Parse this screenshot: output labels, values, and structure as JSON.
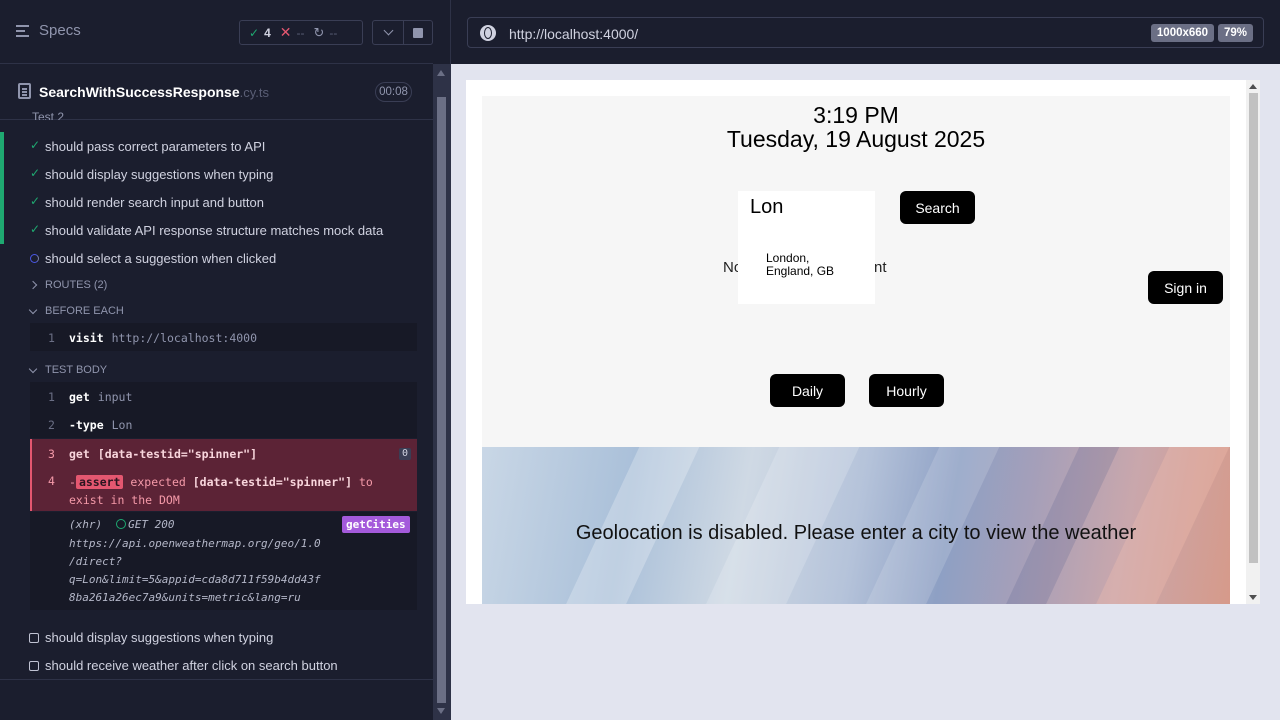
{
  "reporter": {
    "specs_label": "Specs",
    "stats": {
      "passed": "4",
      "failed": "--",
      "pending": "--"
    },
    "spec": {
      "name": "SearchWithSuccessResponse",
      "ext": ".cy.ts",
      "timer": "00:08"
    },
    "partial_title": "Test 2",
    "tests_passed": [
      "should pass correct parameters to API",
      "should display suggestions when typing",
      "should render search input and button",
      "should validate API response structure matches mock data"
    ],
    "test_running": "should select a suggestion when clicked",
    "routes_label": "ROUTES (2)",
    "before_each_label": "BEFORE EACH",
    "before_cmd": {
      "num": "1",
      "name": "visit",
      "arg": "http://localhost:4000"
    },
    "test_body_label": "TEST BODY",
    "body_cmds": [
      {
        "num": "1",
        "name": "get",
        "arg": "input"
      },
      {
        "num": "2",
        "name": "-type",
        "arg": "Lon"
      },
      {
        "num": "3",
        "name": "get",
        "arg": "[data-testid=\"spinner\"]",
        "count": "0"
      }
    ],
    "assert": {
      "num": "4",
      "prefix": "-",
      "badge": "assert",
      "text1": "expected",
      "selector": "[data-testid=\"spinner\"]",
      "text2": "to",
      "line2": "exist in the DOM"
    },
    "xhr": {
      "kind": "(xhr)",
      "status": "GET 200",
      "alias": "getCities",
      "url_lines": [
        "https://api.openweathermap.org/geo/1.0",
        "/direct?",
        "q=Lon&limit=5&appid=cda8d711f59b4dd43f",
        "8ba261a26ec7a9&units=metric&lang=ru"
      ]
    },
    "tests_pending": [
      "should display suggestions when typing",
      "should receive weather after click on search button"
    ]
  },
  "preview": {
    "url": "http://localhost:4000/",
    "viewport": "1000x660",
    "zoom": "79%",
    "app": {
      "time": "3:19 PM",
      "date": "Tuesday, 19 August 2025",
      "search_value": "Lon",
      "search_button": "Search",
      "suggestion_line1": "London,",
      "suggestion_line2": "England, GB",
      "no_prefix": "No",
      "no_suffix": "ment",
      "sign_in": "Sign in",
      "daily": "Daily",
      "hourly": "Hourly",
      "geo_message": "Geolocation is disabled. Please enter a city to view the weather"
    }
  },
  "colors": {
    "pass": "#1fa971",
    "fail": "#e45770",
    "alias": "#a45adb",
    "running": "#4956e3"
  }
}
